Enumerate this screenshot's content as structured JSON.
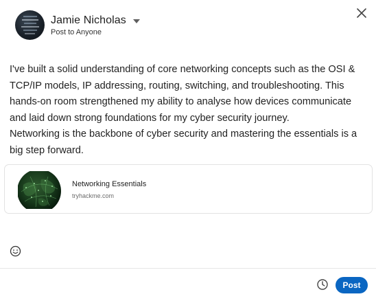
{
  "header": {
    "author_name": "Jamie Nicholas",
    "visibility": "Post to Anyone"
  },
  "icons": {
    "close": "close-icon",
    "dropdown": "chevron-down-icon",
    "emoji": "emoji-icon",
    "schedule": "clock-icon"
  },
  "post": {
    "lines": [
      "I've built a solid understanding of core networking concepts such as the OSI &",
      "TCP/IP models, IP addressing, routing, switching, and troubleshooting. This",
      "hands-on room strengthened my ability to analyse how devices communicate",
      "and laid down strong foundations for my cyber security journey.",
      "Networking is the backbone of cyber security and mastering the essentials is a",
      "big step forward."
    ]
  },
  "link_preview": {
    "title": "Networking Essentials",
    "domain": "tryhackme.com"
  },
  "footer": {
    "post_label": "Post"
  },
  "colors": {
    "primary": "#0a66c2",
    "text": "#1f1f1f",
    "muted": "#6b6b6b",
    "border": "#e2e2e2"
  }
}
